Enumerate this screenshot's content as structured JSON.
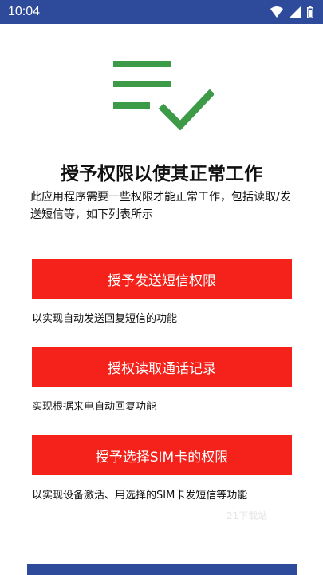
{
  "status_bar": {
    "time": "10:04"
  },
  "title": "授予权限以使其正常工作",
  "description": "此应用程序需要一些权限才能正常工作，包括读取/发送短信等，如下列表所示",
  "permissions": [
    {
      "button_label": "授予发送短信权限",
      "desc": "以实现自动发送回复短信的功能"
    },
    {
      "button_label": "授权读取通话记录",
      "desc": "实现根据来电自动回复功能"
    },
    {
      "button_label": "授予选择SIM卡的权限",
      "desc": "以实现设备激活、用选择的SIM卡发短信等功能"
    }
  ],
  "watermark": "21下载站",
  "colors": {
    "primary": "#2e4a9a",
    "accent_red": "#f4221b",
    "check_green": "#3d9b47"
  },
  "icons": [
    "wifi-icon",
    "signal-icon",
    "battery-icon",
    "checklist-icon"
  ]
}
